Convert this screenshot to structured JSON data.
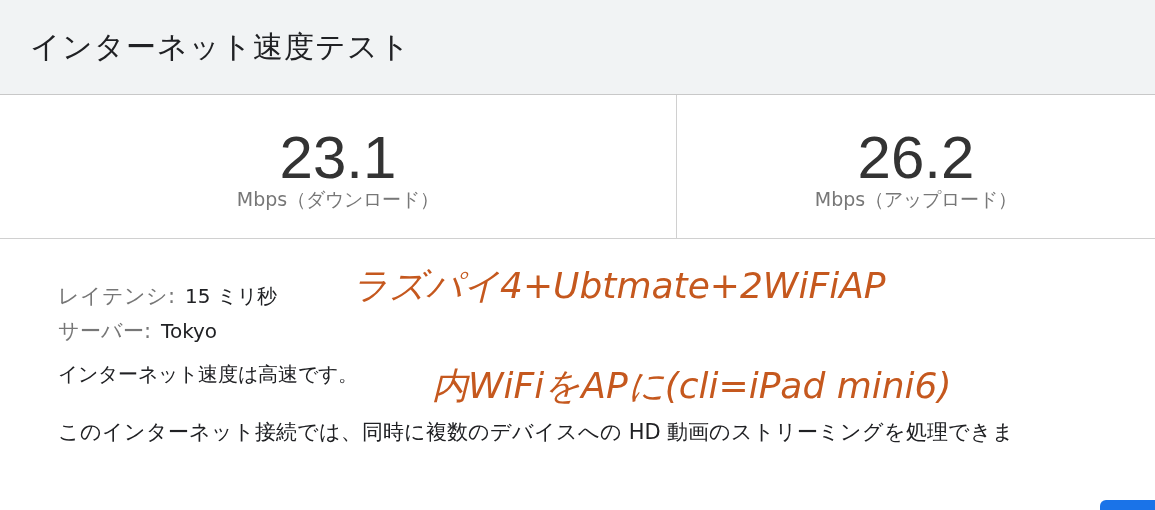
{
  "header": {
    "title": "インターネット速度テスト"
  },
  "results": [
    {
      "value": "23.1",
      "unit": "Mbps（ダウンロード）"
    },
    {
      "value": "26.2",
      "unit": "Mbps（アップロード）"
    }
  ],
  "details": [
    {
      "label": "レイテンシ:",
      "value": "15 ミリ秒"
    },
    {
      "label": "サーバー:",
      "value": "Tokyo"
    }
  ],
  "summary": "インターネット速度は高速です。",
  "description": "このインターネット接続では、同時に複数のデバイスへの HD 動画のストリーミングを処理できま",
  "annotations": [
    "ラズパイ4+Ubtmate+2WiFiAP",
    "内WiFiをAPに(cli=iPad mini6)"
  ],
  "button": {
    "kind": "partial"
  }
}
